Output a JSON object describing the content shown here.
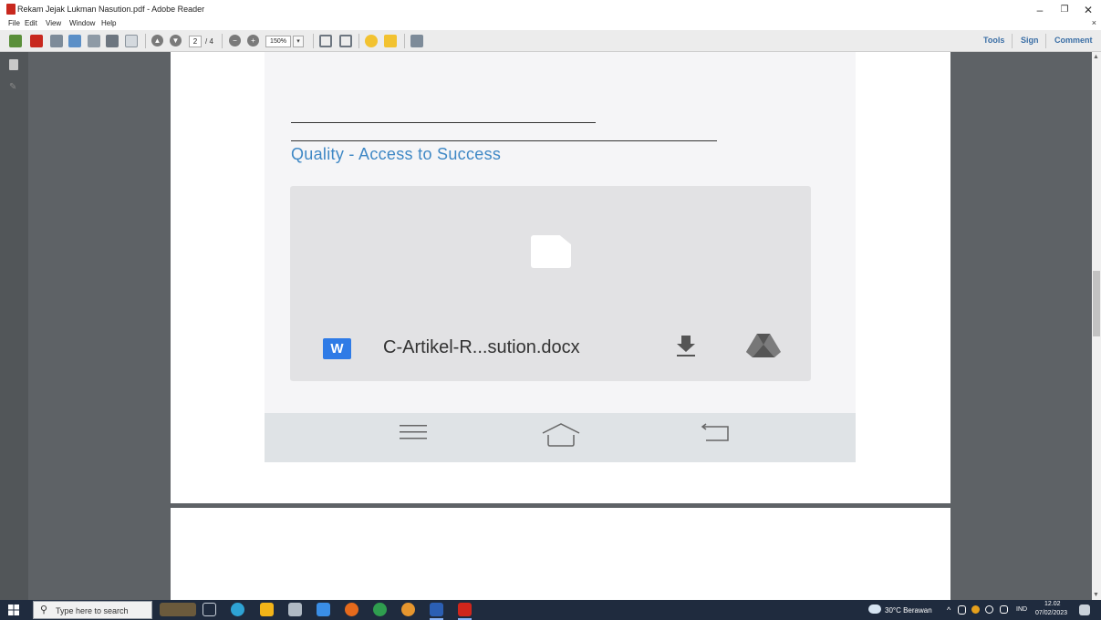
{
  "window": {
    "title": "Rekam Jejak Lukman Nasution.pdf - Adobe Reader",
    "minimize_glyph": "–",
    "restore_glyph": "❐",
    "close_glyph": "✕"
  },
  "menubar": {
    "items": [
      "File",
      "Edit",
      "View",
      "Window",
      "Help"
    ],
    "close_doc_glyph": "×"
  },
  "toolbar": {
    "current_page": "2",
    "page_total": "/ 4",
    "zoom": "150%",
    "zoom_dropdown_glyph": "▾",
    "prev_glyph": "▲",
    "next_glyph": "▼",
    "zoom_out_glyph": "−",
    "zoom_in_glyph": "+",
    "tools_label": "Tools",
    "sign_label": "Sign",
    "comment_label": "Comment"
  },
  "document": {
    "tagline": "Quality - Access to Success",
    "attachment": {
      "word_badge": "W",
      "file_name": "C-Artikel-R...sution.docx"
    }
  },
  "scrollbar": {
    "up_glyph": "▲",
    "down_glyph": "▼"
  },
  "taskbar": {
    "search_placeholder": "Type here to search",
    "search_glyph": "⚲",
    "weather": "30°C  Berawan",
    "tray_chevron": "^",
    "language": "IND",
    "time": "12.02",
    "date": "07/02/2023"
  },
  "colors": {
    "accent_blue": "#3f88c5",
    "word_blue": "#2f7be6",
    "pdf_red": "#c8281e",
    "viewer_gray": "#5e6266",
    "taskbar_bg": "#1f2b3e"
  },
  "icons": [
    "pdf-logo-icon",
    "create-pdf-icon",
    "open-icon",
    "edit-icon",
    "cloud-icon",
    "save-icon",
    "print-icon",
    "email-icon",
    "prev-page-icon",
    "next-page-icon",
    "zoom-out-icon",
    "zoom-in-icon",
    "fit-page-icon",
    "fullscreen-icon",
    "comment-icon",
    "highlight-icon",
    "expand-icon",
    "file-icon",
    "word-icon",
    "download-icon",
    "drive-icon",
    "menu-icon",
    "home-icon",
    "back-icon",
    "windows-start-icon",
    "search-icon"
  ]
}
